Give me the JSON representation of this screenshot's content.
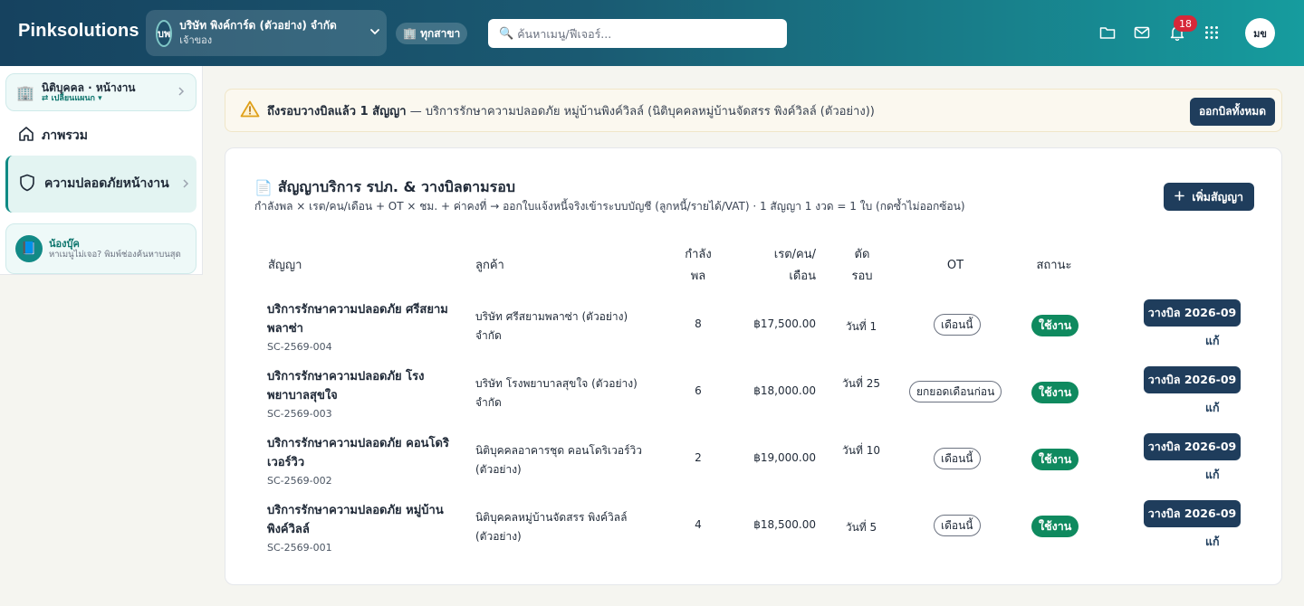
{
  "header": {
    "brand": "Pinksolutions",
    "company_initials": "บพ",
    "company_name": "บริษัท พิงค์การ์ด (ตัวอย่าง) จำกัด",
    "company_role": "เจ้าของ",
    "branch_label": "🏢 ทุกสาขา",
    "search_placeholder": "ค้นหาเมนู/ฟีเจอร์...",
    "notification_count": "18",
    "user_initials": "มข"
  },
  "sidebar": {
    "entity_title": "นิติบุคคล · หน้างาน",
    "entity_switch": "⇄ เปลี่ยนแผนก ▾",
    "overview_label": "ภาพรวม",
    "security_label": "ความปลอดภัยหน้างาน",
    "helper_title": "น้องบุ๊ค",
    "helper_text": "หาเมนูไม่เจอ? พิมพ์ช่องค้นหาบนสุด"
  },
  "alert": {
    "bold": "ถึงรอบวางบิลแล้ว 1 สัญญา",
    "text": " — บริการรักษาความปลอดภัย หมู่บ้านพิงค์วิลล์ (นิติบุคคลหมู่บ้านจัดสรร พิงค์วิลล์ (ตัวอย่าง))",
    "button": "ออกบิลทั้งหมด"
  },
  "card": {
    "title": "สัญญาบริการ รปภ. & วางบิลตามรอบ",
    "subtitle": "กำลังพล × เรต/คน/เดือน + OT × ชม. + ค่าคงที่ → ออกใบแจ้งหนี้จริงเข้าระบบบัญชี (ลูกหนี้/รายได้/VAT) · 1 สัญญา 1 งวด = 1 ใบ (กดซ้ำไม่ออกซ้อน)",
    "add_button": "เพิ่มสัญญา"
  },
  "table": {
    "headers": {
      "contract": "สัญญา",
      "customer": "ลูกค้า",
      "staff_1": "กำลัง",
      "staff_2": "พล",
      "rate_1": "เรต/คน/",
      "rate_2": "เดือน",
      "cutoff_1": "ตัด",
      "cutoff_2": "รอบ",
      "ot": "OT",
      "status": "สถานะ"
    },
    "rows": [
      {
        "name": "บริการรักษาความปลอดภัย ศรีสยามพลาซ่า",
        "code": "SC-2569-004",
        "customer": "บริษัท ศรีสยามพลาซ่า (ตัวอย่าง) จำกัด",
        "staff": "8",
        "rate": "฿17,500.00",
        "cutoff": "วันที่ 1",
        "ot": "เดือนนี้",
        "status": "ใช้งาน",
        "bill": "วางบิล 2026-09",
        "edit": "แก้"
      },
      {
        "name": "บริการรักษาความปลอดภัย โรงพยาบาลสุขใจ",
        "code": "SC-2569-003",
        "customer": "บริษัท โรงพยาบาลสุขใจ (ตัวอย่าง) จำกัด",
        "staff": "6",
        "rate": "฿18,000.00",
        "cutoff": "วันที่ 25",
        "ot": "ยกยอดเดือนก่อน",
        "status": "ใช้งาน",
        "bill": "วางบิล 2026-09",
        "edit": "แก้"
      },
      {
        "name": "บริการรักษาความปลอดภัย คอนโดริเวอร์วิว",
        "code": "SC-2569-002",
        "customer": "นิติบุคคลอาคารชุด คอนโดริเวอร์วิว (ตัวอย่าง)",
        "staff": "2",
        "rate": "฿19,000.00",
        "cutoff": "วันที่ 10",
        "ot": "เดือนนี้",
        "status": "ใช้งาน",
        "bill": "วางบิล 2026-09",
        "edit": "แก้"
      },
      {
        "name": "บริการรักษาความปลอดภัย หมู่บ้านพิงค์วิลล์",
        "code": "SC-2569-001",
        "customer": "นิติบุคคลหมู่บ้านจัดสรร พิงค์วิลล์ (ตัวอย่าง)",
        "staff": "4",
        "rate": "฿18,500.00",
        "cutoff": "วันที่ 5",
        "ot": "เดือนนี้",
        "status": "ใช้งาน",
        "bill": "วางบิล 2026-09",
        "edit": "แก้"
      }
    ]
  }
}
